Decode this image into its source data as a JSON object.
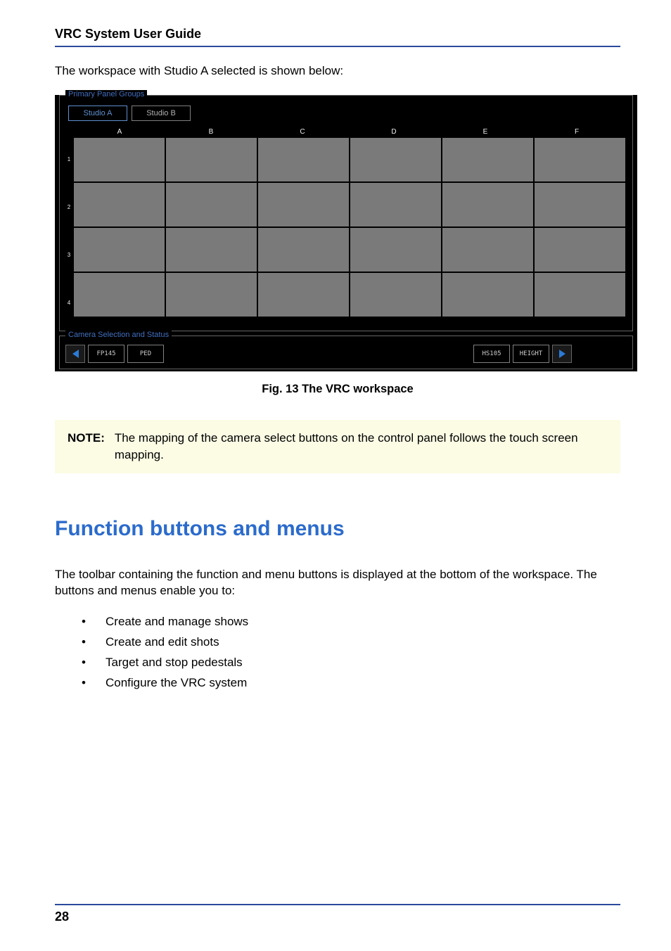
{
  "doc_header": "VRC System User Guide",
  "intro": "The workspace with Studio A selected is shown below:",
  "workspace": {
    "ppg_legend": "Primary Panel Groups",
    "tabs": [
      "Studio A",
      "Studio B"
    ],
    "active_tab_index": 0,
    "col_headers": [
      "A",
      "B",
      "C",
      "D",
      "E",
      "F"
    ],
    "row_labels": [
      "1",
      "2",
      "3",
      "4"
    ],
    "css_legend": "Camera Selection and Status",
    "css_buttons_left": [
      "FP145",
      "PED"
    ],
    "css_buttons_right": [
      "HS105",
      "HEIGHT"
    ]
  },
  "figure_caption": "Fig. 13  The VRC workspace",
  "note": {
    "label": "NOTE:",
    "text": "The mapping of the camera select buttons on the control panel follows the touch screen mapping."
  },
  "section_heading": "Function buttons and menus",
  "para1": "The toolbar containing the function and menu buttons is displayed at the bottom of the workspace. The buttons and menus enable you to:",
  "bullets": [
    "Create and manage shows",
    "Create and edit shots",
    "Target and stop pedestals",
    "Configure the VRC system"
  ],
  "page_number": "28"
}
